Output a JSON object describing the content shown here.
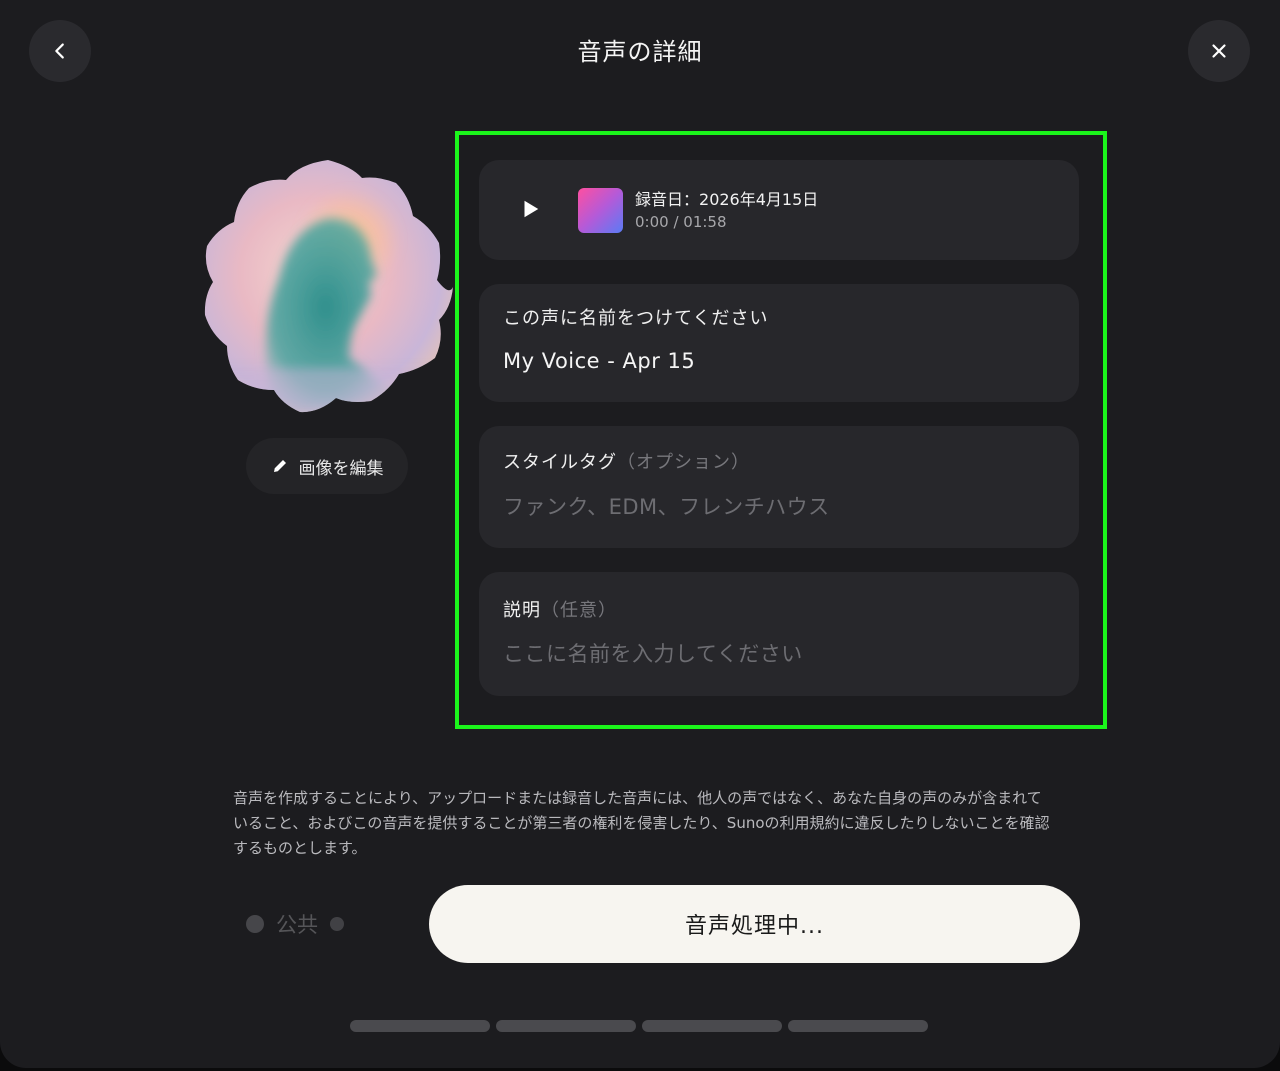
{
  "header": {
    "title": "音声の詳細"
  },
  "avatar": {
    "edit_label": "画像を編集"
  },
  "player": {
    "date_label": "録音日：",
    "date_value": "2026年4月15日",
    "time": "0:00 / 01:58"
  },
  "name_field": {
    "label": "この声に名前をつけてください",
    "value": "My Voice - Apr 15"
  },
  "style_field": {
    "label": "スタイルタグ",
    "label_suffix": "（オプション）",
    "placeholder": "ファンク、EDM、フレンチハウス"
  },
  "desc_field": {
    "label": "説明",
    "label_suffix": "（任意）",
    "placeholder": "ここに名前を入力してください"
  },
  "disclaimer": "音声を作成することにより、アップロードまたは録音した音声には、他人の声ではなく、あなた自身の声のみが含まれていること、およびこの音声を提供することが第三者の権利を侵害したり、Sunoの利用規約に違反したりしないことを確認するものとします。",
  "public_toggle": {
    "label": "公共"
  },
  "primary_button": {
    "label": "音声処理中..."
  },
  "progress": {
    "total_steps": 4
  },
  "colors": {
    "highlight": "#1bf51b",
    "background": "#1c1c1f",
    "card": "#27272b",
    "primary_button_bg": "#f7f5f0"
  }
}
